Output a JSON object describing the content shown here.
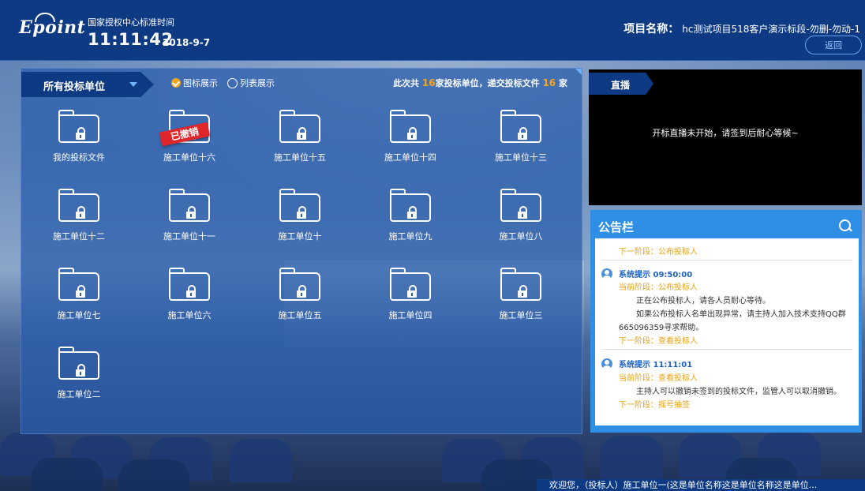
{
  "header": {
    "logo": "Epoint",
    "time_label": "国家授权中心标准时间",
    "time": "11:11:42",
    "date": "2018-9-7",
    "project_label": "项目名称：",
    "project_name": "hc测试项目518客户演示标段-勿删-勿动-1",
    "back_button": "返回"
  },
  "units_panel": {
    "selector_label": "所有投标单位",
    "view_options": [
      {
        "label": "图标展示",
        "selected": true
      },
      {
        "label": "列表展示",
        "selected": false
      }
    ],
    "summary": {
      "prefix": "此次共",
      "unit_count": "16",
      "middle": "家投标单位，递交投标文件",
      "file_count": "16",
      "suffix": "家"
    },
    "folders": [
      {
        "label": "我的投标文件",
        "revoked": false
      },
      {
        "label": "施工单位十六",
        "revoked": true
      },
      {
        "label": "施工单位十五",
        "revoked": false
      },
      {
        "label": "施工单位十四",
        "revoked": false
      },
      {
        "label": "施工单位十三",
        "revoked": false
      },
      {
        "label": "施工单位十二",
        "revoked": false
      },
      {
        "label": "施工单位十一",
        "revoked": false
      },
      {
        "label": "施工单位十",
        "revoked": false
      },
      {
        "label": "施工单位九",
        "revoked": false
      },
      {
        "label": "施工单位八",
        "revoked": false
      },
      {
        "label": "施工单位七",
        "revoked": false
      },
      {
        "label": "施工单位六",
        "revoked": false
      },
      {
        "label": "施工单位五",
        "revoked": false
      },
      {
        "label": "施工单位四",
        "revoked": false
      },
      {
        "label": "施工单位三",
        "revoked": false
      },
      {
        "label": "施工单位二",
        "revoked": false
      }
    ],
    "revoked_badge": "已撤销"
  },
  "live": {
    "tab": "直播",
    "message": "开标直播未开始，请签到后耐心等候~"
  },
  "notice": {
    "title": "公告栏",
    "top_next": "下一阶段：公布投标人",
    "entries": [
      {
        "head": "系统提示 09:50:00",
        "current": "当前阶段：公布投标人",
        "lines": [
          "正在公布投标人，请各人员耐心等待。",
          "如果公布投标人名单出现异常，请主持人加入技术支持QQ群",
          "665096359寻求帮助。"
        ],
        "next": "下一阶段：查看投标人"
      },
      {
        "head": "系统提示 11:11:01",
        "current": "当前阶段：查看投标人",
        "lines": [
          "主持人可以撤销未签到的投标文件，监管人可以取消撤销。"
        ],
        "next": "下一阶段：摇号抽签"
      }
    ]
  },
  "ticker": "欢迎您，（投标人）施工单位一(这是单位名称这是单位名称这是单位..."
}
